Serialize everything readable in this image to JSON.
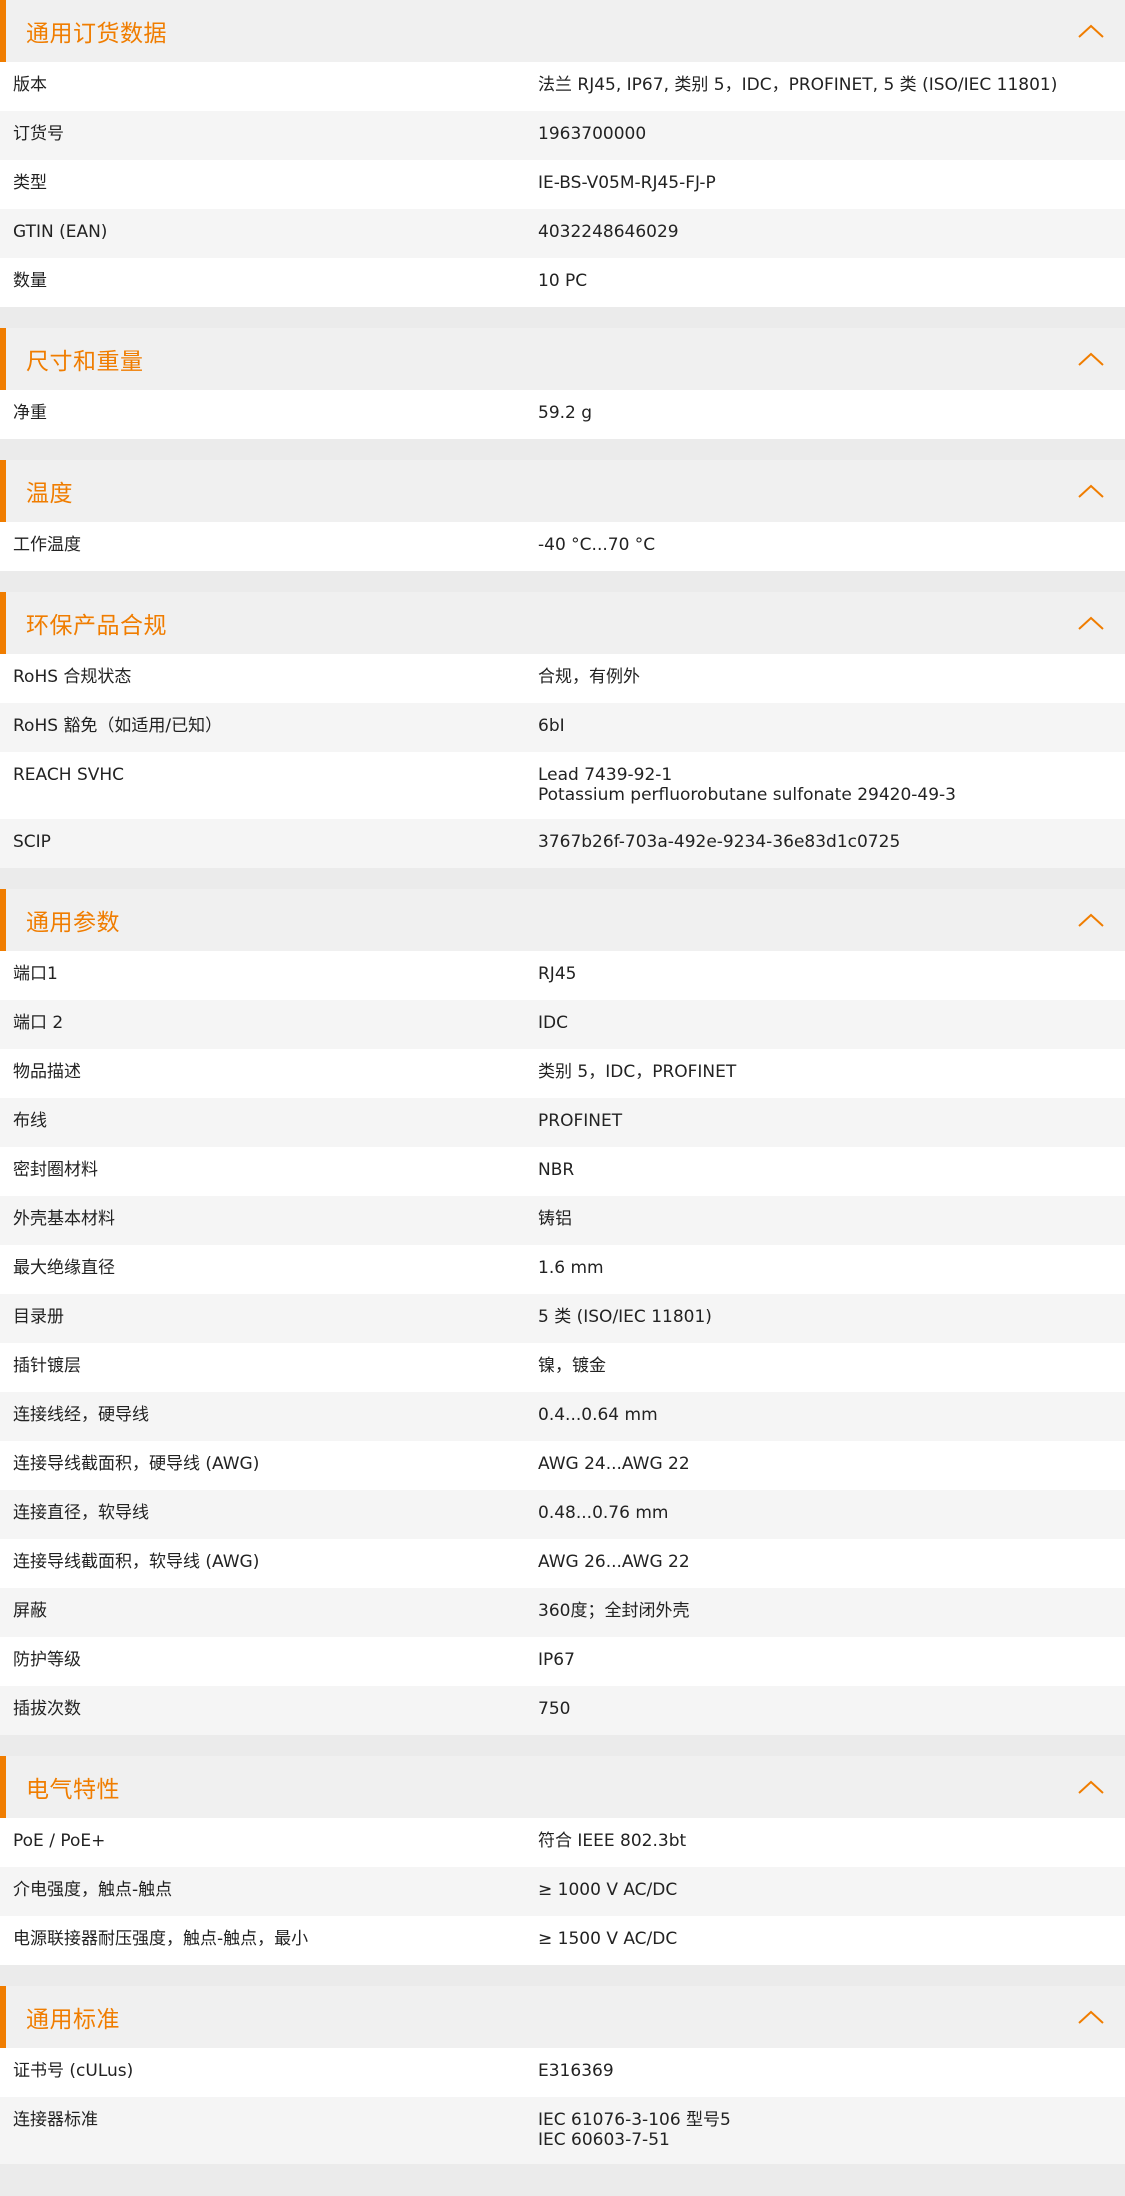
{
  "theme": {
    "accent": "#f07d00",
    "header_bg": "#f0f0f0",
    "row_odd": "#ffffff",
    "row_even": "#f5f5f5"
  },
  "sections": [
    {
      "title": "通用订货数据",
      "icon": "chevron-up-icon",
      "rows": [
        {
          "label": "版本",
          "value": "法兰 RJ45, IP67, 类别 5，IDC，PROFINET, 5 类 (ISO/IEC 11801)"
        },
        {
          "label": "订货号",
          "value": "1963700000"
        },
        {
          "label": "类型",
          "value": "IE-BS-V05M-RJ45-FJ-P"
        },
        {
          "label": "GTIN (EAN)",
          "value": "4032248646029"
        },
        {
          "label": "数量",
          "value": "10  PC"
        }
      ]
    },
    {
      "title": "尺寸和重量",
      "icon": "chevron-up-icon",
      "rows": [
        {
          "label": "净重",
          "value": "59.2  g"
        }
      ]
    },
    {
      "title": "温度",
      "icon": "chevron-up-icon",
      "rows": [
        {
          "label": "工作温度",
          "value": "-40 °C...70 °C"
        }
      ]
    },
    {
      "title": "环保产品合规",
      "icon": "chevron-up-icon",
      "rows": [
        {
          "label": "RoHS 合规状态",
          "value": "合规，有例外"
        },
        {
          "label": "RoHS 豁免（如适用/已知）",
          "value": "6bI"
        },
        {
          "label": "REACH SVHC",
          "value": "Lead 7439-92-1\nPotassium perfluorobutane sulfonate 29420-49-3"
        },
        {
          "label": "SCIP",
          "value": "3767b26f-703a-492e-9234-36e83d1c0725"
        }
      ]
    },
    {
      "title": "通用参数",
      "icon": "chevron-up-icon",
      "rows": [
        {
          "label": "端口1",
          "value": "RJ45"
        },
        {
          "label": "端口 2",
          "value": "IDC"
        },
        {
          "label": "物品描述",
          "value": "类别 5，IDC，PROFINET"
        },
        {
          "label": "布线",
          "value": "PROFINET"
        },
        {
          "label": "密封圈材料",
          "value": "NBR"
        },
        {
          "label": "外壳基本材料",
          "value": "铸铝"
        },
        {
          "label": "最大绝缘直径",
          "value": "1.6  mm"
        },
        {
          "label": "目录册",
          "value": "5 类 (ISO/IEC 11801)"
        },
        {
          "label": "插针镀层",
          "value": "镍，镀金"
        },
        {
          "label": "连接线经，硬导线",
          "value": "0.4...0.64 mm"
        },
        {
          "label": "连接导线截面积，硬导线 (AWG)",
          "value": "AWG 24...AWG 22"
        },
        {
          "label": "连接直径，软导线",
          "value": "0.48...0.76 mm"
        },
        {
          "label": "连接导线截面积，软导线 (AWG)",
          "value": "AWG 26...AWG 22"
        },
        {
          "label": "屏蔽",
          "value": "360度；全封闭外壳"
        },
        {
          "label": "防护等级",
          "value": "IP67"
        },
        {
          "label": "插拔次数",
          "value": "750"
        }
      ]
    },
    {
      "title": "电气特性",
      "icon": "chevron-up-icon",
      "rows": [
        {
          "label": "PoE / PoE+",
          "value": "符合 IEEE 802.3bt"
        },
        {
          "label": "介电强度，触点-触点",
          "value": "≥ 1000 V AC/DC"
        },
        {
          "label": "电源联接器耐压强度，触点-触点，最小",
          "value": "≥ 1500 V AC/DC"
        }
      ]
    },
    {
      "title": "通用标准",
      "icon": "chevron-up-icon",
      "rows": [
        {
          "label": "证书号 (cULus)",
          "value": "E316369"
        },
        {
          "label": "连接器标准",
          "value": "IEC 61076-3-106 型号5\nIEC 60603-7-51"
        }
      ]
    }
  ]
}
